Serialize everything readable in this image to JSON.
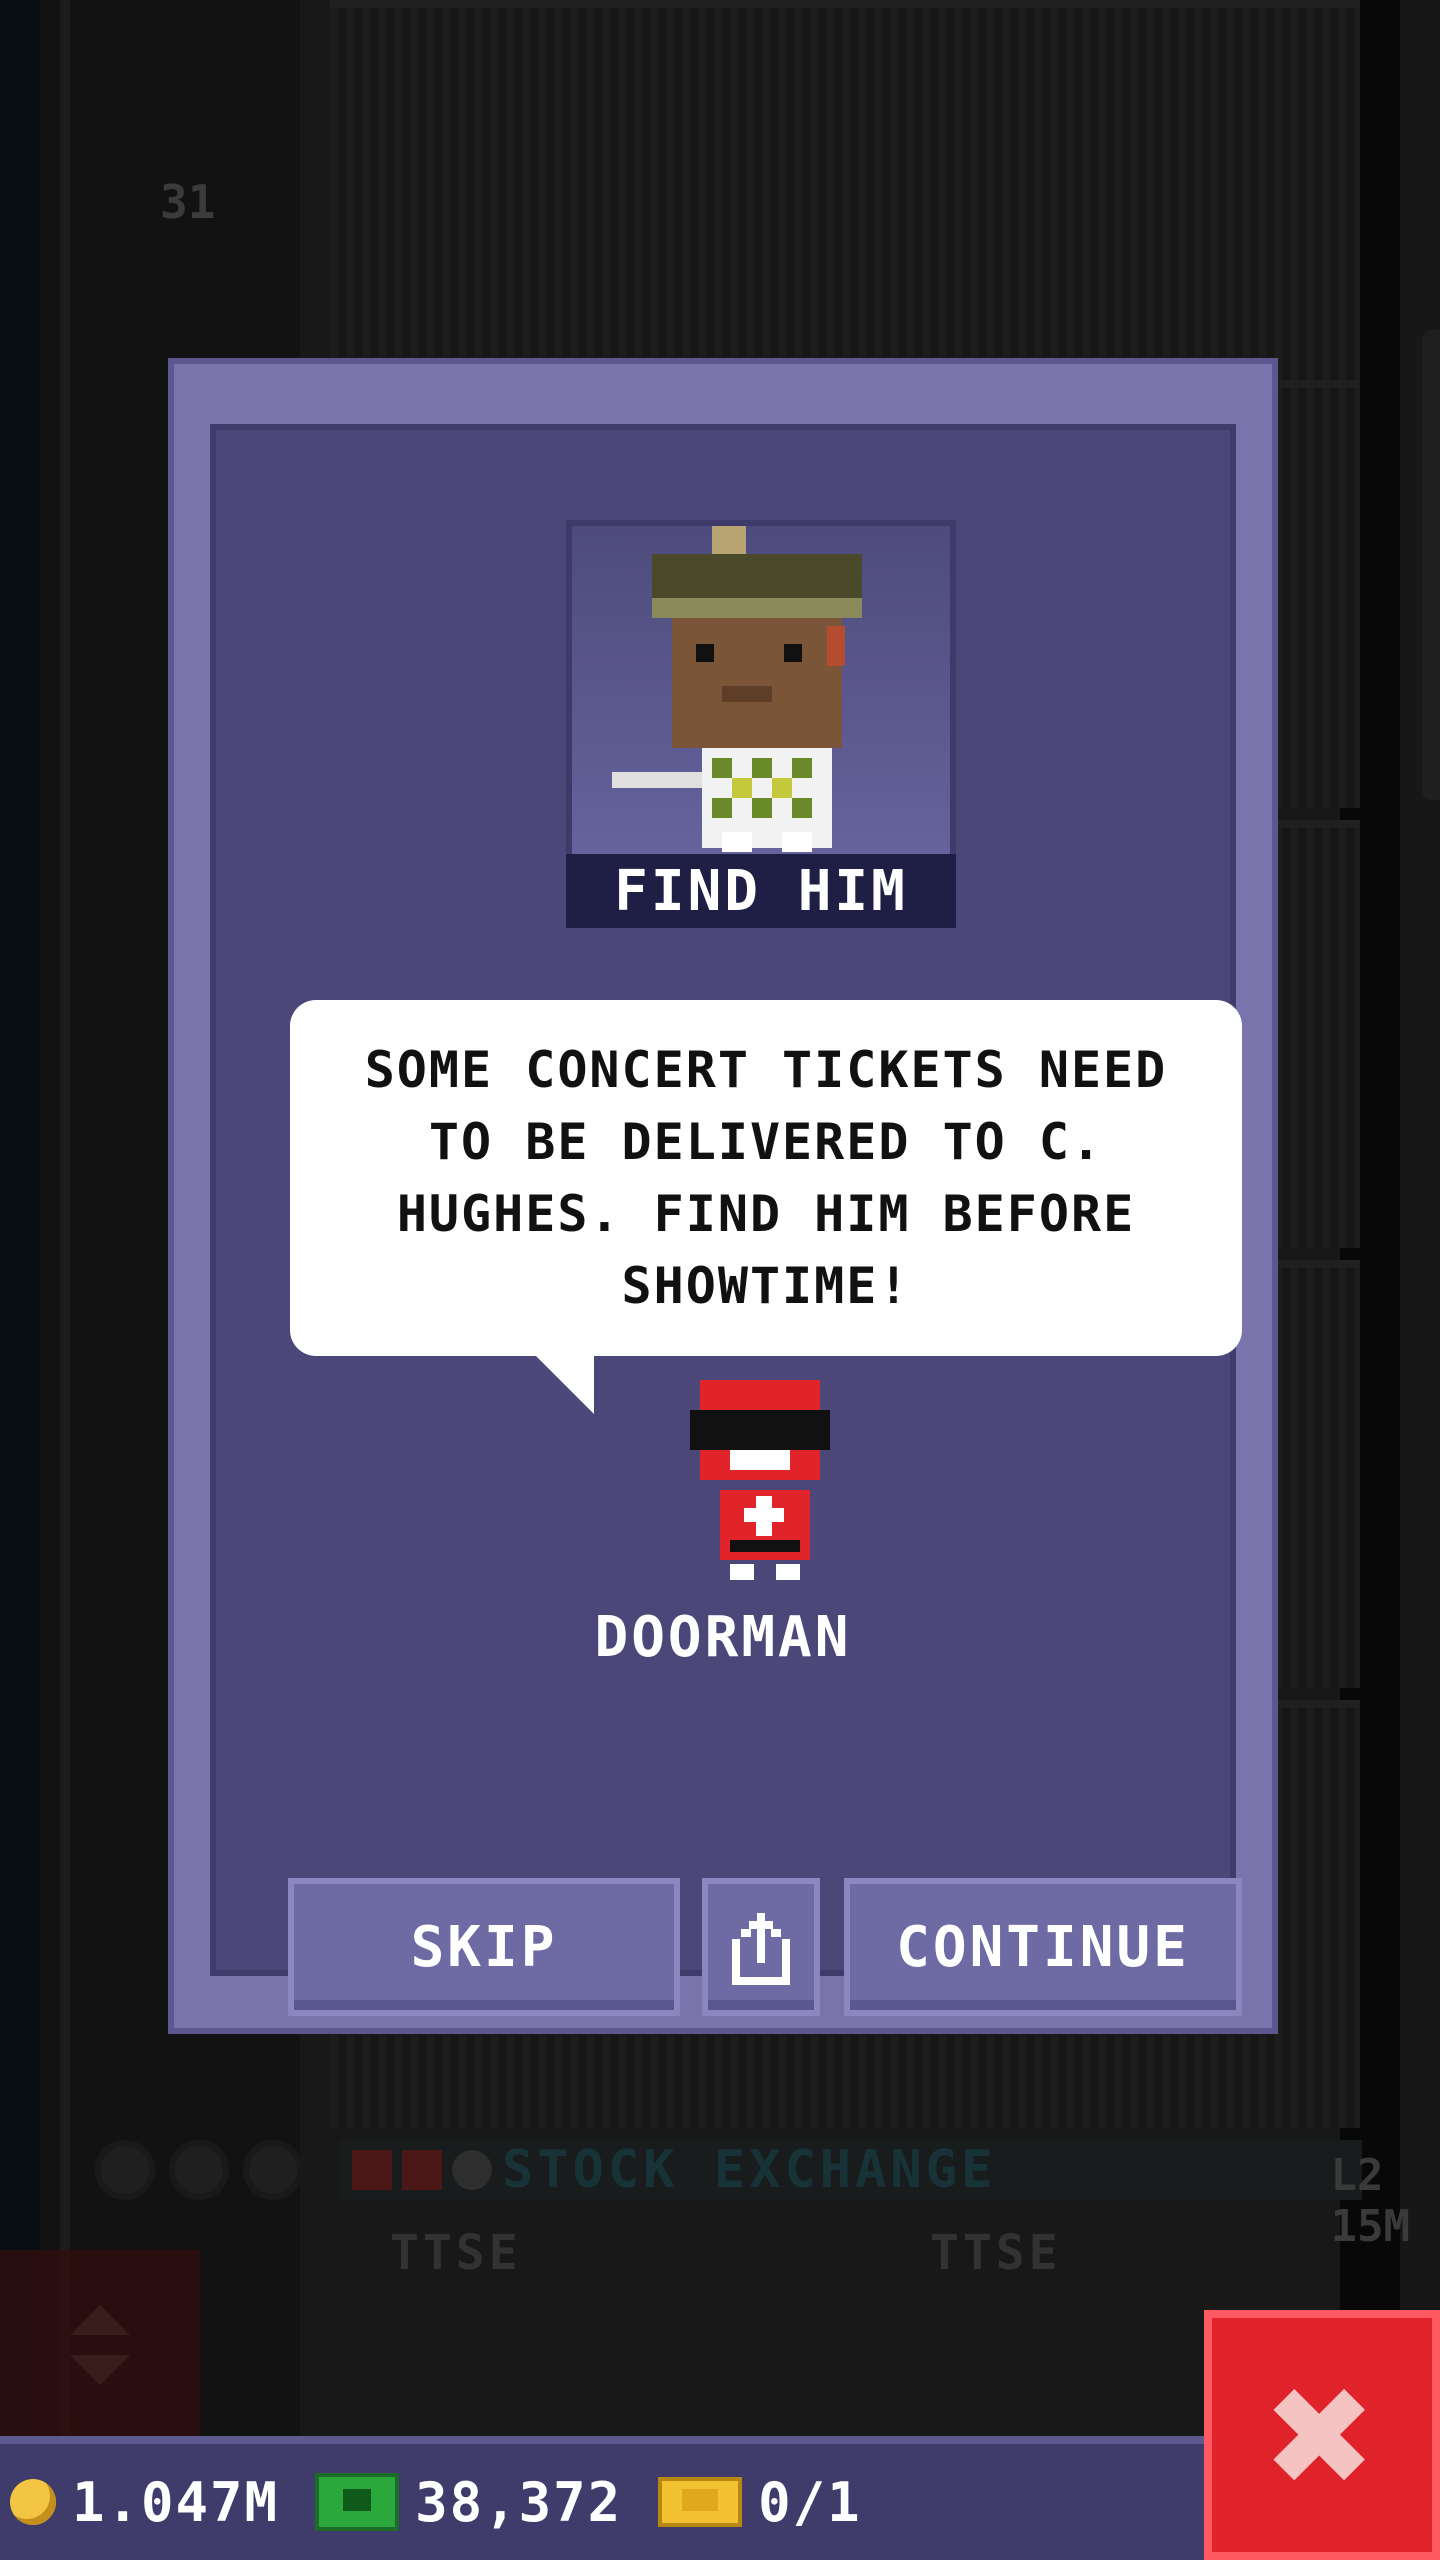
{
  "background": {
    "floor_number": "31",
    "stock_exchange_label": "STOCK EXCHANGE",
    "stock_level": "L2",
    "stock_value": "15M",
    "ttse_labels": [
      "TTSE",
      "TTSE"
    ]
  },
  "mission": {
    "portrait_caption": "FIND HIM",
    "message": "SOME CONCERT TICKETS NEED TO BE DELIVERED TO C. HUGHES. FIND HIM BEFORE SHOWTIME!",
    "npc_name": "DOORMAN",
    "buttons": {
      "skip": "SKIP",
      "continue": "CONTINUE"
    }
  },
  "status_bar": {
    "coins": "1.047M",
    "bux": "38,372",
    "tickets": "0/1"
  },
  "colors": {
    "modal": "#7a74ad",
    "modal_inner": "#4b4879",
    "close_button": "#e0222b",
    "bottom_bar": "#3f3c6b"
  },
  "icons": {
    "share": "share-icon",
    "close": "close-icon",
    "coin": "coin-icon",
    "bux": "bux-icon",
    "ticket": "ticket-icon"
  }
}
